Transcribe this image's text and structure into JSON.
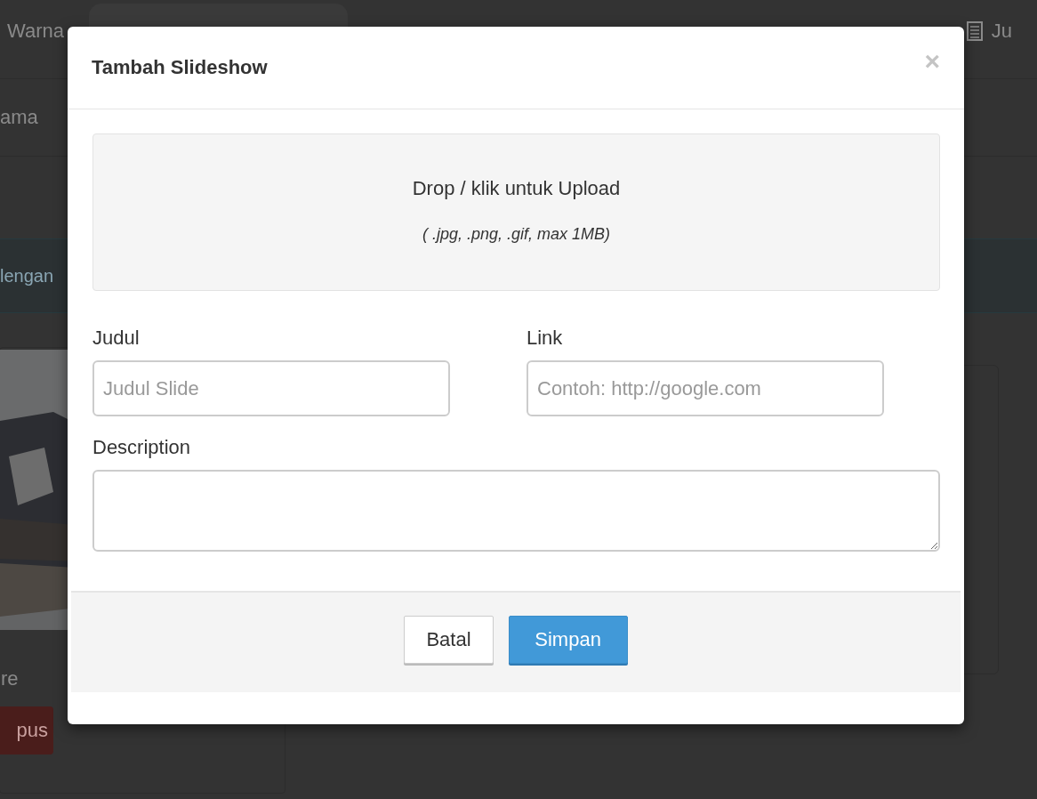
{
  "background": {
    "tabs": [
      {
        "label": "Warna"
      },
      {
        "label": "Ju"
      }
    ],
    "field_label": "ama",
    "notice": "lengan",
    "product": {
      "kind": "picture",
      "name": "re",
      "button": "pus"
    }
  },
  "modal": {
    "title": "Tambah Slideshow",
    "close": "×",
    "upload": {
      "title": "Drop / klik untuk Upload",
      "hint": "( .jpg, .png, .gif, max 1MB)"
    },
    "fields": [
      {
        "label": "Judul",
        "placeholder": "Judul Slide"
      },
      {
        "label": "Link",
        "placeholder": "Contoh: http://google.com"
      }
    ],
    "description": {
      "label": "Description"
    },
    "buttons": [
      {
        "label": "Batal",
        "kind": "default"
      },
      {
        "label": "Simpan",
        "kind": "primary"
      }
    ]
  }
}
